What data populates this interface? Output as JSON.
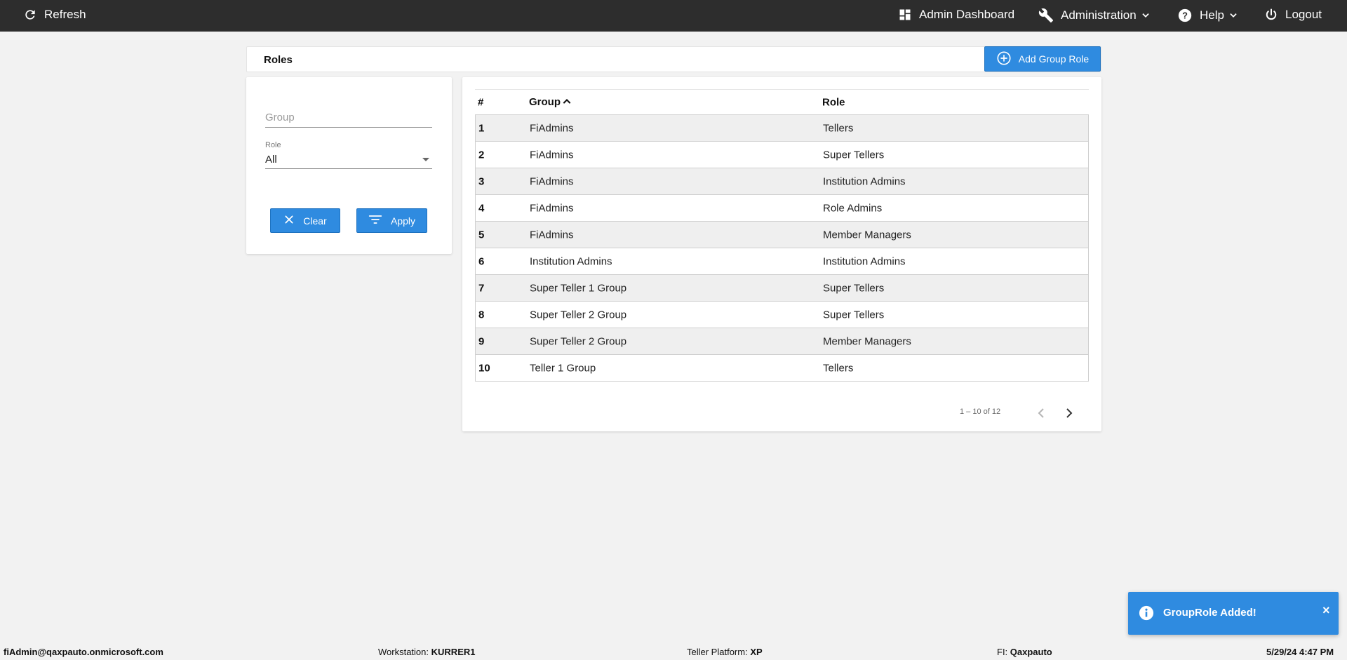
{
  "topbar": {
    "refresh_label": "Refresh",
    "dashboard_label": "Admin Dashboard",
    "administration_label": "Administration",
    "help_label": "Help",
    "logout_label": "Logout",
    "background": "#2d2d2d"
  },
  "roles_header": {
    "title": "Roles",
    "add_button_label": "Add Group Role"
  },
  "filter": {
    "group_placeholder": "Group",
    "group_value": "",
    "role_label": "Role",
    "role_value": "All",
    "clear_label": "Clear",
    "apply_label": "Apply"
  },
  "table": {
    "columns": [
      "#",
      "Group",
      "Role"
    ],
    "sort_column": "Group",
    "sort_direction": "ascending",
    "rows": [
      {
        "num": "1",
        "group": "FiAdmins",
        "role": "Tellers"
      },
      {
        "num": "2",
        "group": "FiAdmins",
        "role": "Super Tellers"
      },
      {
        "num": "3",
        "group": "FiAdmins",
        "role": "Institution Admins"
      },
      {
        "num": "4",
        "group": "FiAdmins",
        "role": "Role Admins"
      },
      {
        "num": "5",
        "group": "FiAdmins",
        "role": "Member Managers"
      },
      {
        "num": "6",
        "group": "Institution Admins",
        "role": "Institution Admins"
      },
      {
        "num": "7",
        "group": "Super Teller 1 Group",
        "role": "Super Tellers"
      },
      {
        "num": "8",
        "group": "Super Teller 2 Group",
        "role": "Super Tellers"
      },
      {
        "num": "9",
        "group": "Super Teller 2 Group",
        "role": "Member Managers"
      },
      {
        "num": "10",
        "group": "Teller 1 Group",
        "role": "Tellers"
      }
    ],
    "pagination_text": "1 – 10 of 12"
  },
  "toast": {
    "message": "GroupRole Added!",
    "close_symbol": "×",
    "color": "#2f8be0"
  },
  "statusbar": {
    "user": "fiAdmin@qaxpauto.onmicrosoft.com",
    "workstation_label": "Workstation:",
    "workstation_value": "KURRER1",
    "platform_label": "Teller Platform:",
    "platform_value": "XP",
    "fi_label": "FI:",
    "fi_value": "Qaxpauto",
    "datetime": "5/29/24 4:47 PM"
  },
  "accent_color": "#2f8be0"
}
